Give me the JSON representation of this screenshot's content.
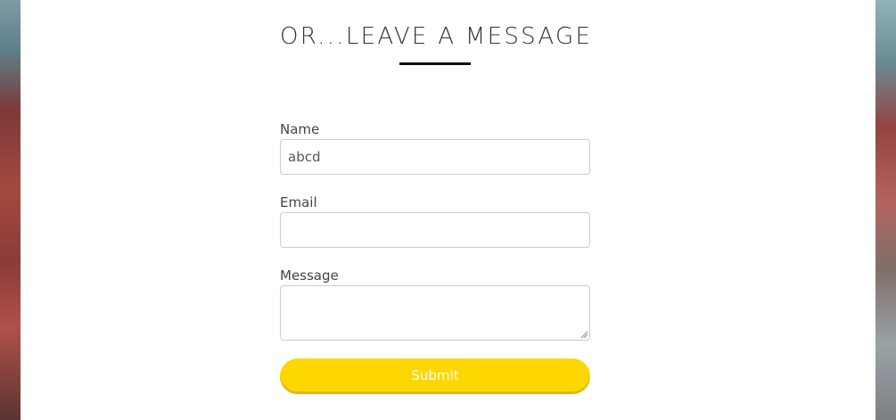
{
  "contact_form": {
    "heading": "OR...LEAVE A MESSAGE",
    "fields": [
      {
        "label": "Name",
        "value": "abcd",
        "placeholder": ""
      },
      {
        "label": "Email",
        "value": "",
        "placeholder": ""
      },
      {
        "label": "Message",
        "value": "",
        "placeholder": ""
      }
    ],
    "submit_label": "Submit"
  },
  "colors": {
    "submit_button": "#ffd700",
    "panel": "#ffffff",
    "heading_underline": "#111111"
  }
}
